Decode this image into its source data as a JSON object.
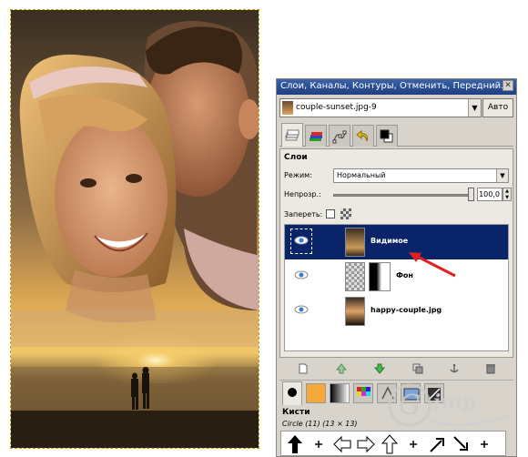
{
  "dock": {
    "title": "Слои, Каналы, Контуры, Отменить, Передний...",
    "image_select": "couple-sunset.jpg-9",
    "auto_button": "Авто"
  },
  "layers_panel": {
    "title": "Слои",
    "mode_label": "Режим:",
    "mode_value": "Нормальный",
    "opacity_label": "Непрозр.:",
    "opacity_value": "100,0",
    "opacity_percent": 100,
    "lock_label": "Запереть:",
    "layers": [
      {
        "name": "Видимое",
        "selected": true,
        "visible": true
      },
      {
        "name": "Фон",
        "selected": false,
        "visible": true
      },
      {
        "name": "happy-couple.jpg",
        "selected": false,
        "visible": true
      }
    ]
  },
  "brushes": {
    "title": "Кисти",
    "brush_name": "Circle (11) (13 × 13)"
  },
  "watermark": {
    "text": "Gimp"
  },
  "colors": {
    "selection": "#0a246a",
    "titlebar": "#2a4f94",
    "annotation_arrow": "#e02020"
  }
}
